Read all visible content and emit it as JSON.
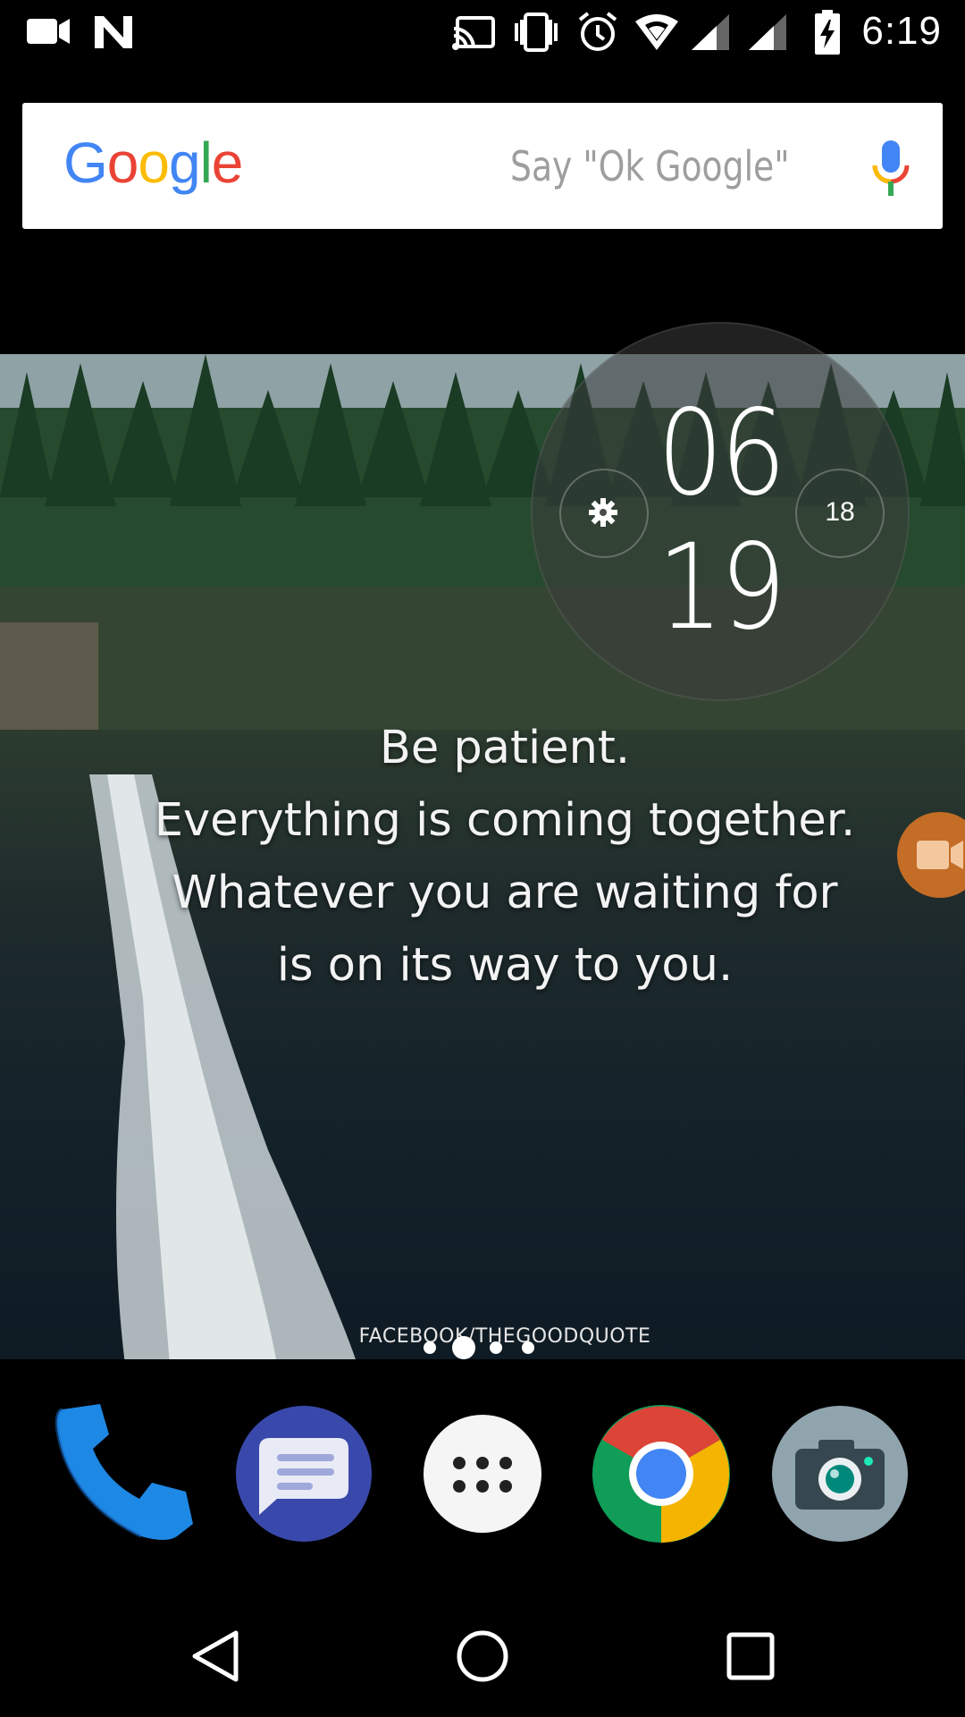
{
  "status_bar": {
    "time": "6:19",
    "left_icons": [
      "video-camera-icon",
      "n-icon"
    ],
    "right_icons": [
      "cast-icon",
      "vibrate-icon",
      "alarm-icon",
      "wifi-icon",
      "signal-icon",
      "signal-icon",
      "battery-charging-icon"
    ]
  },
  "search_bar": {
    "logo": [
      "G",
      "o",
      "o",
      "g",
      "l",
      "e"
    ],
    "logo_colors": [
      "#4285F4",
      "#EA4335",
      "#FBBC05",
      "#4285F4",
      "#34A853",
      "#EA4335"
    ],
    "hint": "Say \"Ok Google\"",
    "mic_icon": "microphone-icon"
  },
  "clock_widget": {
    "hour": "06",
    "minute": "19",
    "seconds": "18",
    "settings_icon": "gear-icon"
  },
  "wallpaper": {
    "quote_lines": [
      "Be patient.",
      "Everything is coming together.",
      "Whatever you are waiting for",
      "is on its way to you."
    ],
    "credit": "FACEBOOK/THEGOODQUOTE"
  },
  "floating_bubble": {
    "icon": "video-camera-icon",
    "color": "#E07826"
  },
  "page_indicator": {
    "count": 4,
    "active": 1
  },
  "dock": [
    {
      "name": "Phone",
      "icon": "phone-icon",
      "color": "#1E88E5"
    },
    {
      "name": "Messages",
      "icon": "messages-icon",
      "color": "#3949AB"
    },
    {
      "name": "Apps",
      "icon": "app-drawer-icon",
      "color": "#F5F5F5"
    },
    {
      "name": "Chrome",
      "icon": "chrome-icon",
      "color": "#DB4437"
    },
    {
      "name": "Camera",
      "icon": "camera-icon",
      "color": "#90A4AE"
    }
  ],
  "nav_bar": [
    "back-icon",
    "home-icon",
    "recents-icon"
  ]
}
